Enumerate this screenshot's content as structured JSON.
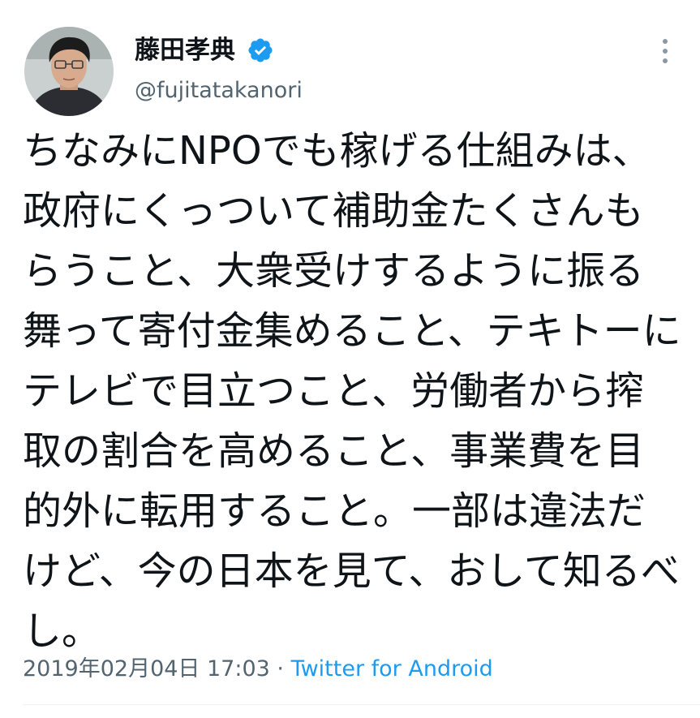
{
  "author": {
    "name": "藤田孝典",
    "handle": "@fujitatakanori",
    "verified": true,
    "avatar_icon": "profile-photo",
    "verified_icon": "verified-badge-icon",
    "verified_color": "#1d9bf0"
  },
  "more_icon": "more-options-icon",
  "tweet": {
    "lines": [
      "ちなみにNPOでも稼げる仕組みは、",
      "政府にくっついて補助金たくさんも",
      "らうこと、大衆受けするように振る",
      "舞って寄付金集めること、テキトーに",
      "テレビで目立つこと、労働者から搾",
      "取の割合を高めること、事業費を目",
      "的外に転用すること。一部は違法だ",
      "けど、今の日本を見て、おして知るべ",
      "し。"
    ]
  },
  "meta": {
    "timestamp": "2019年02月04日 17:03",
    "separator": " · ",
    "source": "Twitter for Android",
    "source_color": "#1d9bf0"
  }
}
